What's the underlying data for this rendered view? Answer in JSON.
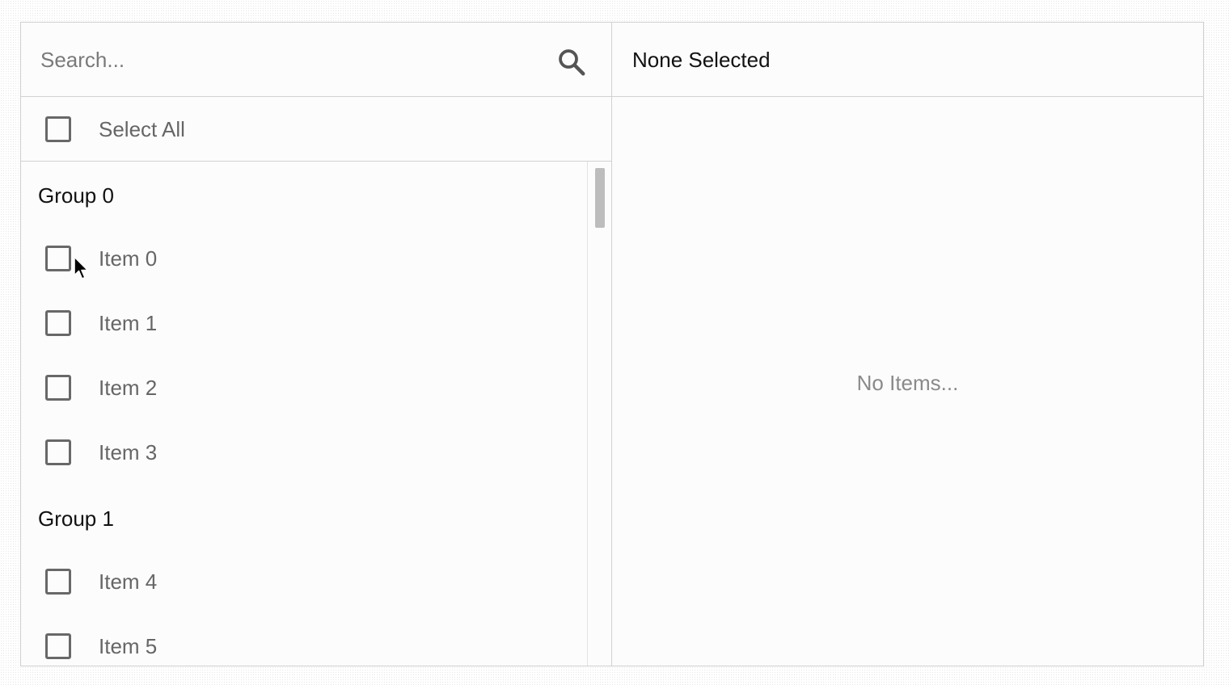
{
  "search": {
    "placeholder": "Search...",
    "value": ""
  },
  "select_all": {
    "label": "Select All",
    "checked": false
  },
  "groups": [
    {
      "title": "Group 0",
      "items": [
        {
          "label": "Item 0"
        },
        {
          "label": "Item 1"
        },
        {
          "label": "Item 2"
        },
        {
          "label": "Item 3"
        }
      ]
    },
    {
      "title": "Group 1",
      "items": [
        {
          "label": "Item 4"
        },
        {
          "label": "Item 5"
        }
      ]
    }
  ],
  "selected_panel": {
    "title": "None Selected",
    "empty_text": "No Items..."
  },
  "icons": {
    "search": "search-icon",
    "cursor": "mouse-pointer-icon"
  },
  "colors": {
    "border": "#cfcfcf",
    "checkbox": "#686868",
    "muted_text": "#8a8a8a"
  }
}
